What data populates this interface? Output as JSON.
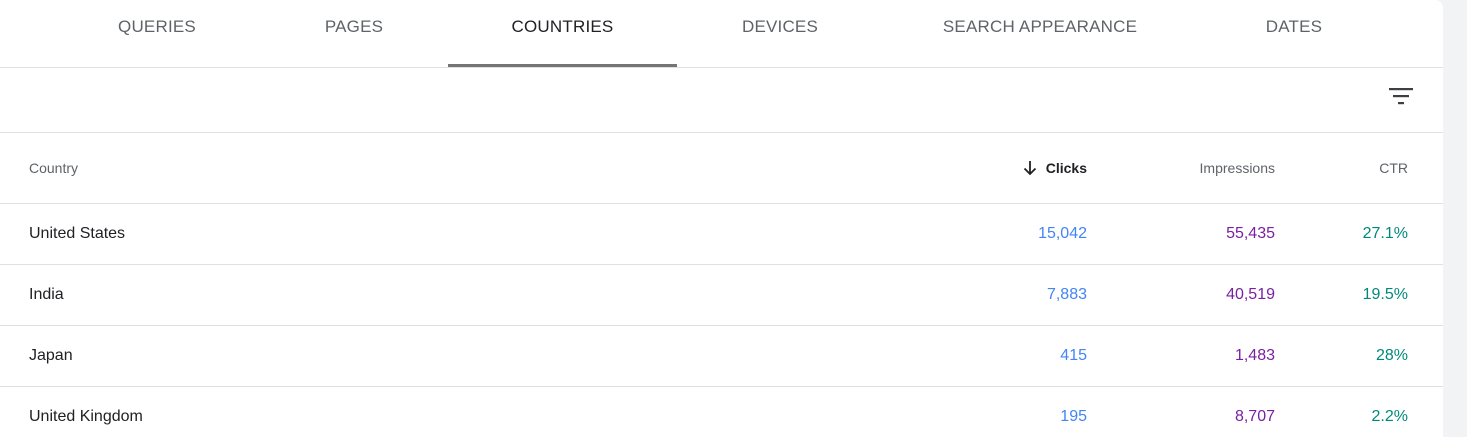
{
  "tabs": [
    {
      "label": "QUERIES"
    },
    {
      "label": "PAGES"
    },
    {
      "label": "COUNTRIES",
      "active": true
    },
    {
      "label": "DEVICES"
    },
    {
      "label": "SEARCH APPEARANCE"
    },
    {
      "label": "DATES"
    }
  ],
  "toolbar": {
    "filter_icon": "filter-list-icon"
  },
  "table": {
    "headers": {
      "country": "Country",
      "clicks": "Clicks",
      "impressions": "Impressions",
      "ctr": "CTR"
    },
    "sort": {
      "column": "clicks",
      "direction": "descending",
      "icon": "arrow-down-icon"
    },
    "rows": [
      {
        "country": "United States",
        "clicks": "15,042",
        "impressions": "55,435",
        "ctr": "27.1%"
      },
      {
        "country": "India",
        "clicks": "7,883",
        "impressions": "40,519",
        "ctr": "19.5%"
      },
      {
        "country": "Japan",
        "clicks": "415",
        "impressions": "1,483",
        "ctr": "28%"
      },
      {
        "country": "United Kingdom",
        "clicks": "195",
        "impressions": "8,707",
        "ctr": "2.2%"
      }
    ]
  },
  "colors": {
    "clicks": "#4285f4",
    "impressions": "#7b1fa2",
    "ctr": "#00897b"
  }
}
